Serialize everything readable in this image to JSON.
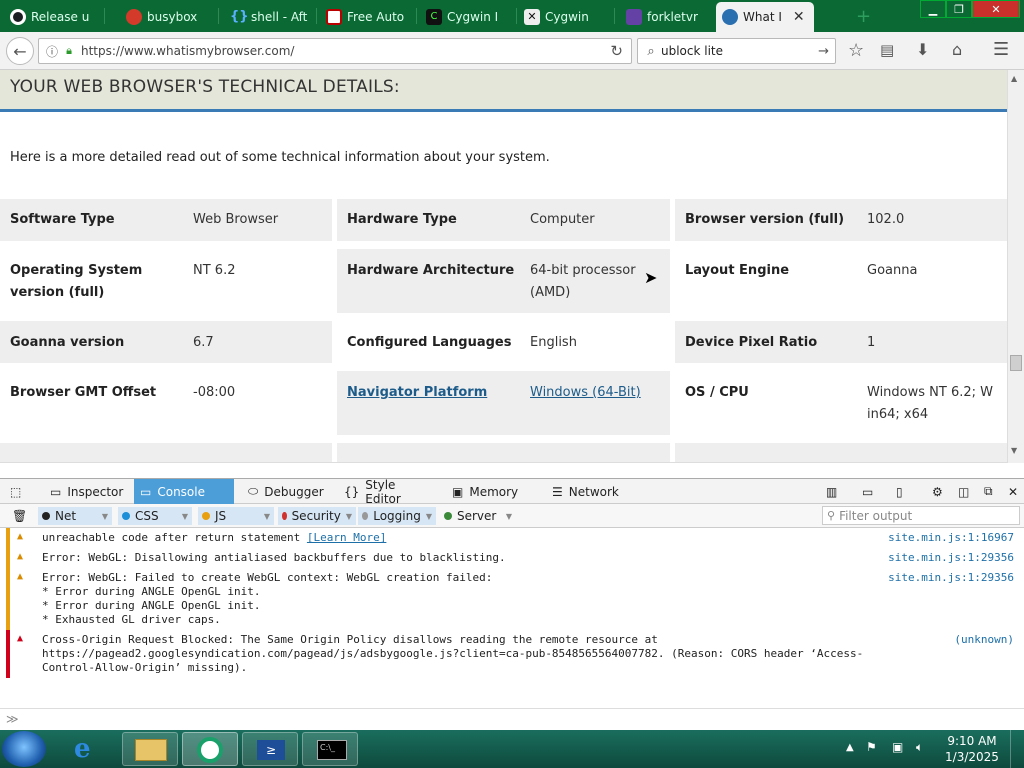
{
  "browser": {
    "tabs": [
      {
        "label": "Release u",
        "icon": "github-icon",
        "color": "#1b1f23"
      },
      {
        "label": "busybox",
        "icon": "chrome-icon",
        "color": "#d43a2a"
      },
      {
        "label": "shell - Aft",
        "icon": "braces-icon",
        "color": "#1a6fb4"
      },
      {
        "label": "Free Auto",
        "icon": "news-icon",
        "color": "#b00"
      },
      {
        "label": "Cygwin I",
        "icon": "cygwin-icon",
        "color": "#2d7d1a"
      },
      {
        "label": "Cygwin",
        "icon": "cygwin2-icon",
        "color": "#333"
      },
      {
        "label": "forkletvr",
        "icon": "twitch-icon",
        "color": "#6441a5"
      },
      {
        "label": "What I",
        "icon": "globe-icon",
        "color": "#2a6fb0"
      }
    ],
    "url": "https://www.whatismybrowser.com/",
    "search_value": "ublock lite"
  },
  "page": {
    "heading": "YOUR WEB BROWSER'S TECHNICAL DETAILS:",
    "intro": "Here is a more detailed read out of some technical information about your system.",
    "rows": [
      [
        {
          "label": "Software Type",
          "value": "Web Browser"
        },
        {
          "label": "Hardware Type",
          "value": "Computer"
        },
        {
          "label": "Browser version (full)",
          "value": "102.0"
        }
      ],
      [
        {
          "label": "Operating System version (full)",
          "value": "NT 6.2"
        },
        {
          "label": "Hardware Architecture",
          "value": "64-bit processor (AMD)"
        },
        {
          "label": "Layout Engine",
          "value": "Goanna"
        }
      ],
      [
        {
          "label": "Goanna version",
          "value": "6.7"
        },
        {
          "label": "Configured Languages",
          "value": "English"
        },
        {
          "label": "Device Pixel Ratio",
          "value": "1"
        }
      ],
      [
        {
          "label": "Browser GMT Offset",
          "value": "-08:00"
        },
        {
          "label": "Navigator Platform",
          "value": "Windows (64-Bit)"
        },
        {
          "label": "OS / CPU",
          "value": "Windows NT 6.2; Win64; x64"
        }
      ]
    ]
  },
  "devtools": {
    "tabs": [
      "Inspector",
      "Console",
      "Debugger",
      "Style Editor",
      "Memory",
      "Network"
    ],
    "filters": [
      "Net",
      "CSS",
      "JS",
      "Security",
      "Logging",
      "Server"
    ],
    "filter_placeholder": "Filter output",
    "messages": [
      {
        "kind": "warn",
        "text": "unreachable code after return statement",
        "link": "[Learn More]",
        "source": "site.min.js:1:16967"
      },
      {
        "kind": "warn",
        "text": "Error: WebGL: Disallowing antialiased backbuffers due to blacklisting.",
        "source": "site.min.js:1:29356"
      },
      {
        "kind": "warn",
        "text": "Error: WebGL: Failed to create WebGL context: WebGL creation failed:\n* Error during ANGLE OpenGL init.\n* Error during ANGLE OpenGL init.\n* Exhausted GL driver caps.",
        "source": "site.min.js:1:29356"
      },
      {
        "kind": "error",
        "text": "Cross-Origin Request Blocked: The Same Origin Policy disallows reading the remote resource at\nhttps://pagead2.googlesyndication.com/pagead/js/adsbygoogle.js?client=ca-pub-8548565564007782. (Reason: CORS header ‘Access-\nControl-Allow-Origin’ missing).",
        "source": "(unknown)"
      }
    ]
  },
  "taskbar": {
    "time": "9:10 AM",
    "date": "1/3/2025"
  }
}
